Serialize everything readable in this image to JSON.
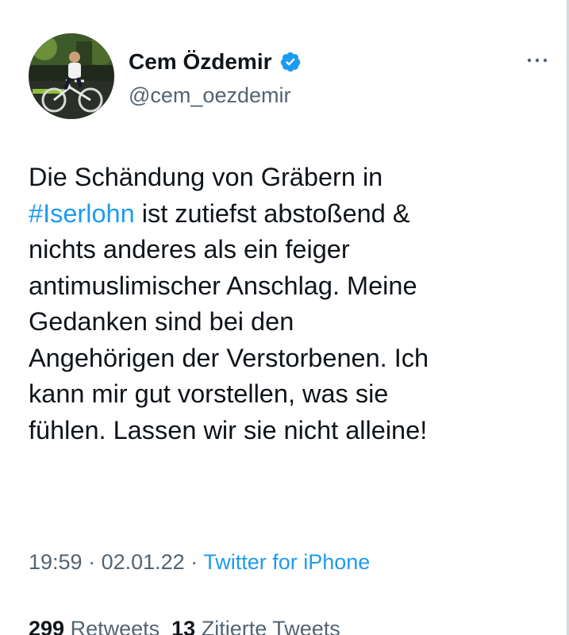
{
  "author": {
    "display_name": "Cem Özdemir",
    "handle": "@cem_oezdemir",
    "verified": true
  },
  "tweet": {
    "line1": "Die Schändung von Gräbern in",
    "hashtag": "#Iserlohn",
    "line2_rest": " ist zutiefst abstoßend &",
    "rest": "nichts anderes als ein feiger\nantimuslimischer Anschlag. Meine\nGedanken sind bei den\nAngehörigen der Verstorbenen. Ich\nkann mir gut vorstellen, was sie\nfühlen. Lassen wir sie nicht alleine!"
  },
  "meta": {
    "time": "19:59",
    "separator": " · ",
    "date": "02.01.22",
    "source": "Twitter for iPhone"
  },
  "stats": {
    "retweets_count": "299",
    "retweets_label": "Retweets",
    "quotes_count": "13",
    "quotes_label": "Zitierte Tweets"
  },
  "colors": {
    "link": "#1d9bf0",
    "secondary_text": "#536471",
    "primary_text": "#0f1419",
    "verified_badge": "#1d9bf0"
  },
  "icons": {
    "verified": "verified-badge-icon",
    "more": "more-options-icon"
  }
}
